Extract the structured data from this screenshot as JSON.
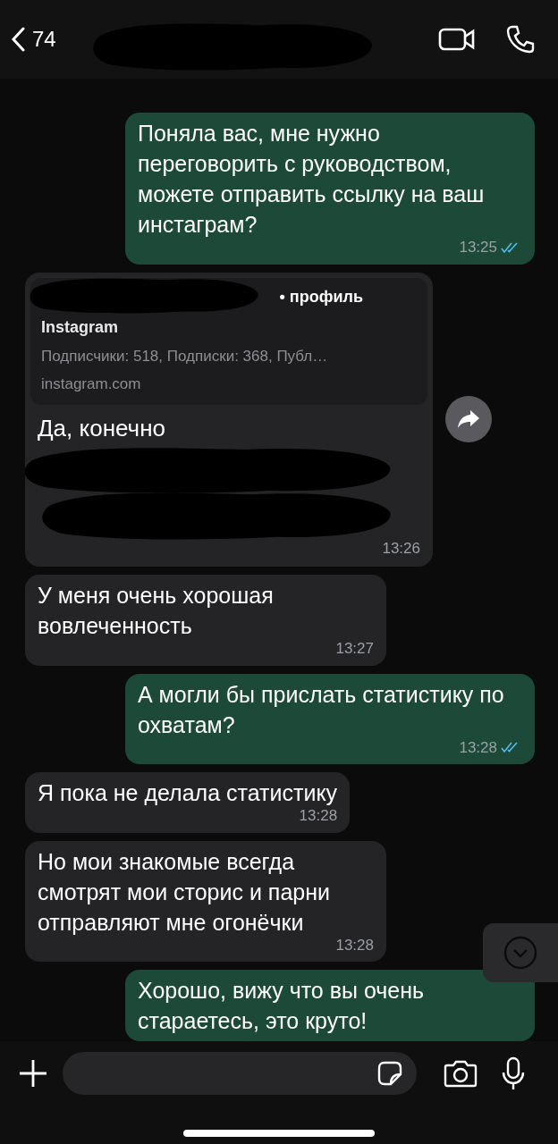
{
  "header": {
    "back_count": "74"
  },
  "messages": [
    {
      "kind": "outgoing_text",
      "text": "Поняла вас, мне нужно переговорить с руководством, можете отправить ссылку на ваш инстаграм?",
      "time": "13:25",
      "read": true
    },
    {
      "kind": "incoming_link",
      "preview": {
        "title": "• профиль",
        "site": "Instagram",
        "description": "Подписчики: 518, Подписки: 368, Публ…",
        "domain": "instagram.com"
      },
      "text": "Да, конечно",
      "time": "13:26"
    },
    {
      "kind": "incoming_text",
      "text": "У меня очень хорошая вовлеченность",
      "time": "13:27"
    },
    {
      "kind": "outgoing_text",
      "text": "А могли бы прислать статистику по охватам?",
      "time": "13:28",
      "read": true
    },
    {
      "kind": "incoming_text",
      "text": "Я пока не делала статистику",
      "time": "13:28"
    },
    {
      "kind": "incoming_text",
      "text": "Но мои знакомые всегда смотрят мои сторис и парни отправляют мне огонёчки",
      "time": "13:28"
    },
    {
      "kind": "outgoing_text",
      "text": "Хорошо, вижу что вы очень стараетесь, это круто!"
    }
  ]
}
